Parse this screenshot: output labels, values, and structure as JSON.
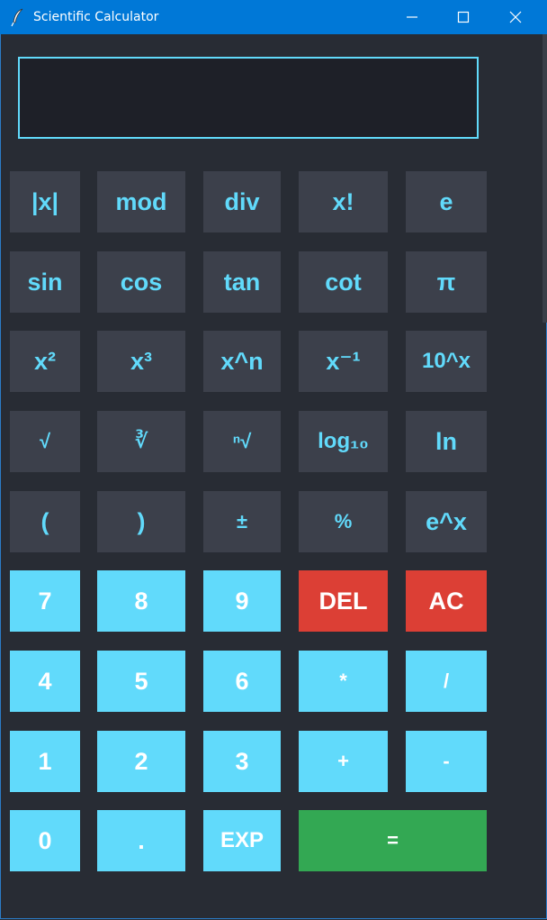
{
  "window": {
    "title": "Scientific Calculator",
    "app_icon": "feather-icon",
    "controls": [
      "minimize-icon",
      "maximize-icon",
      "close-icon"
    ],
    "accent": "#0078d7"
  },
  "display": {
    "value": ""
  },
  "colors": {
    "background": "#282c34",
    "function_key": "#3c404b",
    "function_text": "#61dafb",
    "number_key": "#61dafb",
    "delete_key": "#dc3f35",
    "equals_key": "#33a853",
    "display_border": "#61dafb"
  },
  "keys": {
    "abs": "|x|",
    "mod": "mod",
    "div": "div",
    "fact": "x!",
    "e": "e",
    "sin": "sin",
    "cos": "cos",
    "tan": "tan",
    "cot": "cot",
    "pi": "π",
    "sq": "x²",
    "cube": "x³",
    "pow": "x^n",
    "inv": "x⁻¹",
    "pow10": "10^x",
    "sqrt": "√",
    "cbrt": "∛",
    "nrt": "ⁿ√",
    "log": "log₁₀",
    "ln": "ln",
    "lparen": "(",
    "rparen": ")",
    "plusminus": "±",
    "percent": "%",
    "exp_e": "e^x",
    "n7": "7",
    "n8": "8",
    "n9": "9",
    "del": "DEL",
    "ac": "AC",
    "n4": "4",
    "n5": "5",
    "n6": "6",
    "mul": "*",
    "divide": "/",
    "n1": "1",
    "n2": "2",
    "n3": "3",
    "add": "+",
    "sub": "-",
    "n0": "0",
    "dot": ".",
    "exp": "EXP",
    "equals": "="
  }
}
